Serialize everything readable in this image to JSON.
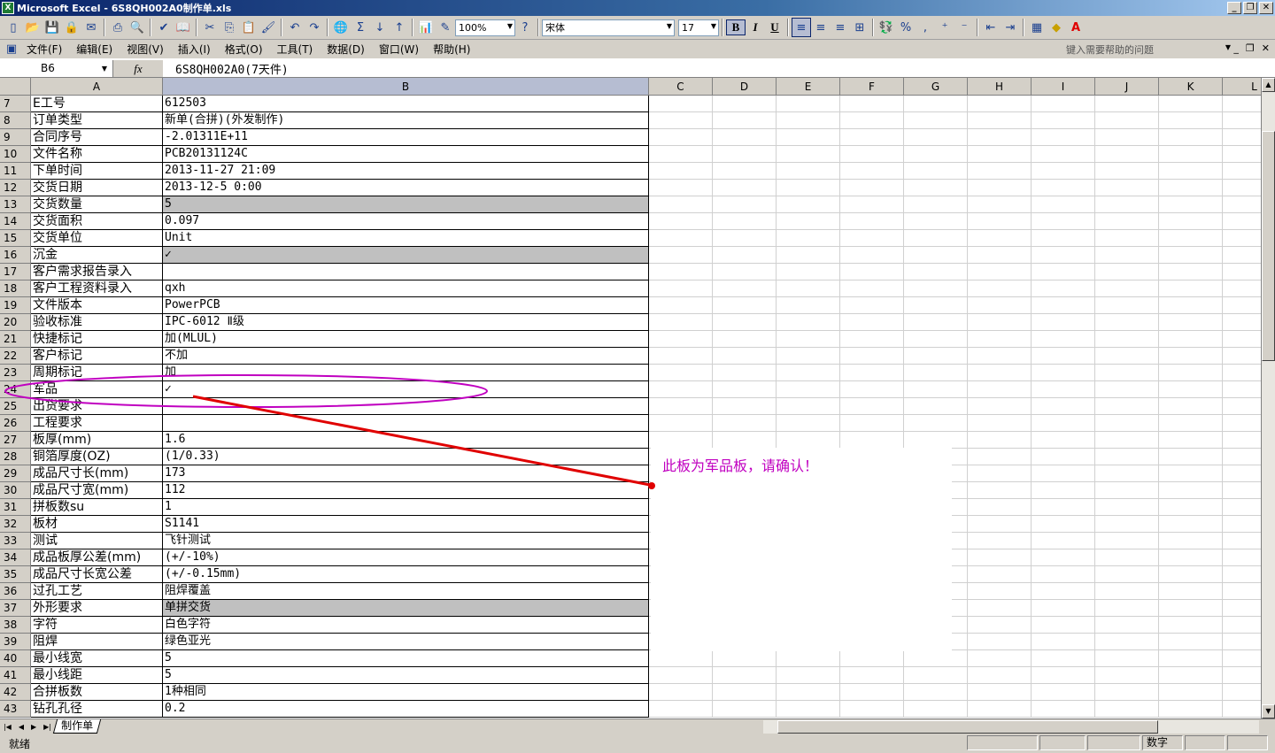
{
  "window": {
    "title": "Microsoft Excel - 6S8QH002A0制作单.xls",
    "minimize": "_",
    "restore": "❐",
    "close": "✕"
  },
  "toolbar": {
    "zoom": "100%",
    "font_name": "宋体",
    "font_size": "17",
    "bold": "B",
    "italic": "I",
    "underline": "U",
    "percent": "%",
    "comma": ","
  },
  "menu": {
    "items": [
      "文件(F)",
      "编辑(E)",
      "视图(V)",
      "插入(I)",
      "格式(O)",
      "工具(T)",
      "数据(D)",
      "窗口(W)",
      "帮助(H)"
    ],
    "help_placeholder": "键入需要帮助的问题"
  },
  "formula_bar": {
    "cell_ref": "B6",
    "fx": "fx",
    "content": "6S8QH002A0(7天件)"
  },
  "columns": [
    "A",
    "B",
    "C",
    "D",
    "E",
    "F",
    "G",
    "H",
    "I",
    "J",
    "K",
    "L"
  ],
  "rows": [
    {
      "n": "7",
      "a": "E工号",
      "b": "612503",
      "gray": false
    },
    {
      "n": "8",
      "a": "订单类型",
      "b": "新单(合拼)(外发制作)",
      "gray": false
    },
    {
      "n": "9",
      "a": "合同序号",
      "b": "-2.01311E+11",
      "gray": false
    },
    {
      "n": "10",
      "a": "文件名称",
      "b": "PCB20131124C",
      "gray": false
    },
    {
      "n": "11",
      "a": "下单时间",
      "b": "2013-11-27 21:09",
      "gray": false
    },
    {
      "n": "12",
      "a": "交货日期",
      "b": "2013-12-5 0:00",
      "gray": false
    },
    {
      "n": "13",
      "a": "交货数量",
      "b": "5",
      "gray": true
    },
    {
      "n": "14",
      "a": "交货面积",
      "b": "0.097",
      "gray": false
    },
    {
      "n": "15",
      "a": "交货单位",
      "b": "Unit",
      "gray": false
    },
    {
      "n": "16",
      "a": "沉金",
      "b": "✓",
      "gray": true
    },
    {
      "n": "17",
      "a": "客户需求报告录入",
      "b": "",
      "gray": false
    },
    {
      "n": "18",
      "a": "客户工程资料录入",
      "b": "qxh",
      "gray": false
    },
    {
      "n": "19",
      "a": "文件版本",
      "b": "PowerPCB",
      "gray": false
    },
    {
      "n": "20",
      "a": "验收标准",
      "b": "IPC-6012 Ⅱ级",
      "gray": false
    },
    {
      "n": "21",
      "a": "快捷标记",
      "b": "加(MLUL)",
      "gray": false
    },
    {
      "n": "22",
      "a": "客户标记",
      "b": "不加",
      "gray": false
    },
    {
      "n": "23",
      "a": "周期标记",
      "b": "加",
      "gray": false
    },
    {
      "n": "24",
      "a": "军品",
      "b": "✓",
      "gray": false
    },
    {
      "n": "25",
      "a": "出货要求",
      "b": "",
      "gray": false
    },
    {
      "n": "26",
      "a": "工程要求",
      "b": "",
      "gray": false
    },
    {
      "n": "27",
      "a": "板厚(mm)",
      "b": "1.6",
      "gray": false
    },
    {
      "n": "28",
      "a": "铜箔厚度(OZ)",
      "b": " (1/0.33)",
      "gray": false
    },
    {
      "n": "29",
      "a": "成品尺寸长(mm)",
      "b": "173",
      "gray": false
    },
    {
      "n": "30",
      "a": "成品尺寸宽(mm)",
      "b": "112",
      "gray": false
    },
    {
      "n": "31",
      "a": "拼板数su",
      "b": "1",
      "gray": false
    },
    {
      "n": "32",
      "a": "板材",
      "b": "S1141",
      "gray": false
    },
    {
      "n": "33",
      "a": "测试",
      "b": "飞针测试",
      "gray": false
    },
    {
      "n": "34",
      "a": "成品板厚公差(mm)",
      "b": "(+/-10%)",
      "gray": false
    },
    {
      "n": "35",
      "a": "成品尺寸长宽公差",
      "b": "(+/-0.15mm)",
      "gray": false
    },
    {
      "n": "36",
      "a": "过孔工艺",
      "b": "阻焊覆盖",
      "gray": false
    },
    {
      "n": "37",
      "a": "外形要求",
      "b": "单拼交货",
      "gray": true
    },
    {
      "n": "38",
      "a": "字符",
      "b": "白色字符",
      "gray": false
    },
    {
      "n": "39",
      "a": "阻焊",
      "b": "绿色亚光",
      "gray": false
    },
    {
      "n": "40",
      "a": "最小线宽",
      "b": "5",
      "gray": false
    },
    {
      "n": "41",
      "a": "最小线距",
      "b": "5",
      "gray": false
    },
    {
      "n": "42",
      "a": "合拼板数",
      "b": "1种相同",
      "gray": false
    },
    {
      "n": "43",
      "a": "钻孔孔径",
      "b": "0.2",
      "gray": false
    }
  ],
  "annotation": {
    "text": "此板为军品板，请确认！",
    "color": "#c000c0",
    "ellipse_color": "#c000c0",
    "arrow_color": "#e00000"
  },
  "sheet_tabs": [
    "制作单"
  ],
  "status": {
    "left": "就绪",
    "mode": "数字"
  }
}
